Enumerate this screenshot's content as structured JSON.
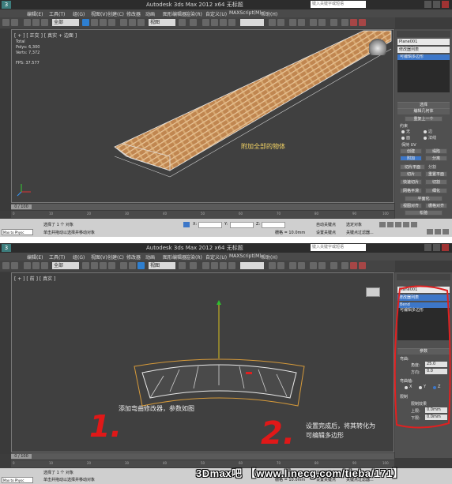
{
  "app": {
    "title": "Autodesk 3ds Max  2012 x64     无标题",
    "search_placeholder": "键入关键字或短语",
    "menus": [
      "编辑(E)",
      "工具(T)",
      "组(G)",
      "视图(V)",
      "创建(C)",
      "修改器",
      "动画",
      "图形编辑器",
      "渲染(R)",
      "自定义(U)",
      "MAXScript(M)",
      "帮助(H)"
    ]
  },
  "toolbar": {
    "selection_filter": "全部",
    "ref_coord": "视图",
    "named_selection": ""
  },
  "shot1": {
    "viewport_label": "[ + ] [ 正交 ] [ 真实 + 边面 ]",
    "stats": {
      "total": "Total",
      "polys": "Polys: 6,300",
      "verts": "Verts: 7,372",
      "fps": "FPS:  37.577"
    },
    "annotation": "附加全部的物体",
    "panel": {
      "object_name": "Plane001",
      "modifier_list": "修改器列表",
      "stack_item": "可编辑多边形",
      "rollout_selection": "选择",
      "rollout_edit_geometry": "编辑几何体",
      "repeat_last": "重复上一个",
      "constraints": "约束",
      "constraint_options": [
        "无",
        "边",
        "面",
        "法线"
      ],
      "preserve_uvs": "保持 UV",
      "create": "创建",
      "collapse": "塌陷",
      "attach": "附加",
      "detach": "分离",
      "slice_plane": "切片平面",
      "split": "分割",
      "slice": "切片",
      "reset_plane": "重置平面",
      "quickslice": "快速切片",
      "cut": "切割",
      "meshsmooth": "网格平滑",
      "tessellate": "细化",
      "planarize": "平面化",
      "view_align": "视图对齐",
      "grid_align": "栅格对齐",
      "relax": "松弛",
      "hide_selected": "隐藏选定对象",
      "unhide_all": "全部取消隐藏",
      "hide_unselected": "隐藏未选定对象"
    },
    "frame": "0 / 100",
    "status": {
      "maxscript": "Max to Physc",
      "selected": "选择了 1 个 对象",
      "prompt": "单击并拖动以选择并移动对象",
      "x": "X:",
      "y": "Y:",
      "z": "Z:",
      "grid": "栅格 = 10.0mm",
      "autokey": "自动关键点",
      "setkey": "设置关键点",
      "selected_mode": "选定对象",
      "key_filters": "关键点过滤器..."
    }
  },
  "shot2": {
    "viewport_label": "[ + ] [ 前 ] [ 真实 ]",
    "annotation_left": "添加弯曲修改器，参数如图",
    "annotation_right_line1": "设置完成后，将其转化为",
    "annotation_right_line2": "可编辑多边形",
    "mark_one": "1.",
    "mark_two": "2.",
    "panel": {
      "object_name": "Plane001",
      "modifier_list": "修改器列表",
      "stack_items": [
        "Bend",
        "可编辑多边形"
      ],
      "rollout_params": "参数",
      "bend_label": "弯曲:",
      "angle_label": "角度:",
      "angle_value": "25.0",
      "direction_label": "方向:",
      "direction_value": "0.0",
      "axis_label": "弯曲轴:",
      "axes": [
        "X",
        "Y",
        "Z"
      ],
      "limits_label": "限制",
      "limit_effect": "限制效果",
      "upper_label": "上限:",
      "upper_value": "0.0mm",
      "lower_label": "下限:",
      "lower_value": "0.0mm"
    },
    "frame": "0 / 100",
    "status": {
      "maxscript": "Max to Physc",
      "selected": "选择了 1 个 对象",
      "prompt": "单击并拖动以选择并移动对象",
      "grid": "栅格 = 10.0mm",
      "autokey": "自动关键点",
      "setkey": "设置关键点",
      "selected_mode": "选定对象",
      "key_filters": "关键点过滤器..."
    }
  },
  "timeline_ticks": [
    "0",
    "10",
    "20",
    "30",
    "40",
    "50",
    "60",
    "70",
    "80",
    "90",
    "100"
  ],
  "watermark": "3Dmax吧 【www.linecg.com/tieba/171】",
  "colors": {
    "highlight_circle": "#e02020",
    "annotation_yellow": "#f2d264",
    "selection_blue": "#3d77c8",
    "mesh_tan": "#d4a070"
  }
}
